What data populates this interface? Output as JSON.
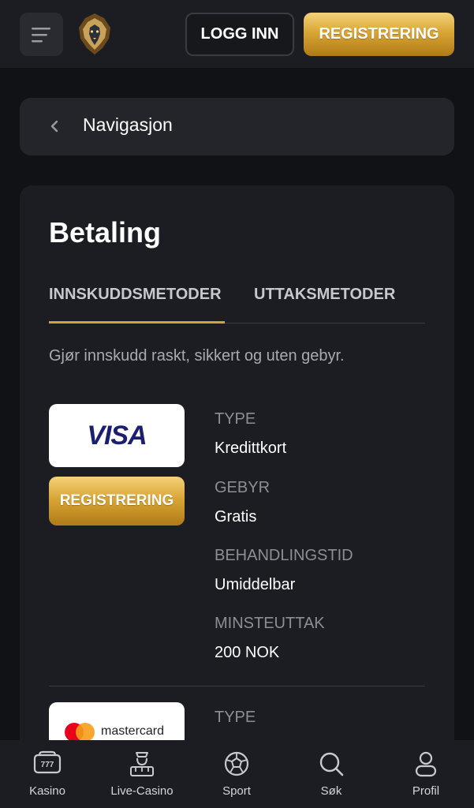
{
  "header": {
    "login_label": "LOGG INN",
    "register_label": "REGISTRERING"
  },
  "nav": {
    "title": "Navigasjon"
  },
  "page": {
    "title": "Betaling",
    "tabs": [
      {
        "label": "INNSKUDDSMETODER",
        "active": true
      },
      {
        "label": "UTTAKSMETODER",
        "active": false
      }
    ],
    "intro": "Gjør innskudd raskt, sikkert og uten gebyr."
  },
  "methods": [
    {
      "brand": "VISA",
      "register_label": "REGISTRERING",
      "fields": [
        {
          "label": "TYPE",
          "value": "Kredittkort"
        },
        {
          "label": "GEBYR",
          "value": "Gratis"
        },
        {
          "label": "BEHANDLINGSTID",
          "value": "Umiddelbar"
        },
        {
          "label": "MINSTEUTTAK",
          "value": "200 NOK"
        }
      ]
    },
    {
      "brand": "mastercard",
      "fields": [
        {
          "label": "TYPE"
        }
      ]
    }
  ],
  "bottom_nav": [
    {
      "label": "Kasino",
      "icon": "slot-machine-icon",
      "badge": "777"
    },
    {
      "label": "Live-Casino",
      "icon": "dealer-icon"
    },
    {
      "label": "Sport",
      "icon": "soccer-ball-icon"
    },
    {
      "label": "Søk",
      "icon": "search-icon"
    },
    {
      "label": "Profil",
      "icon": "user-icon"
    }
  ],
  "colors": {
    "background": "#111216",
    "card": "#1c1d22",
    "accent_gold": "#d4a23a",
    "visa_blue": "#1a1f71",
    "mc_red": "#eb001b",
    "mc_yellow": "#f79e1b"
  }
}
